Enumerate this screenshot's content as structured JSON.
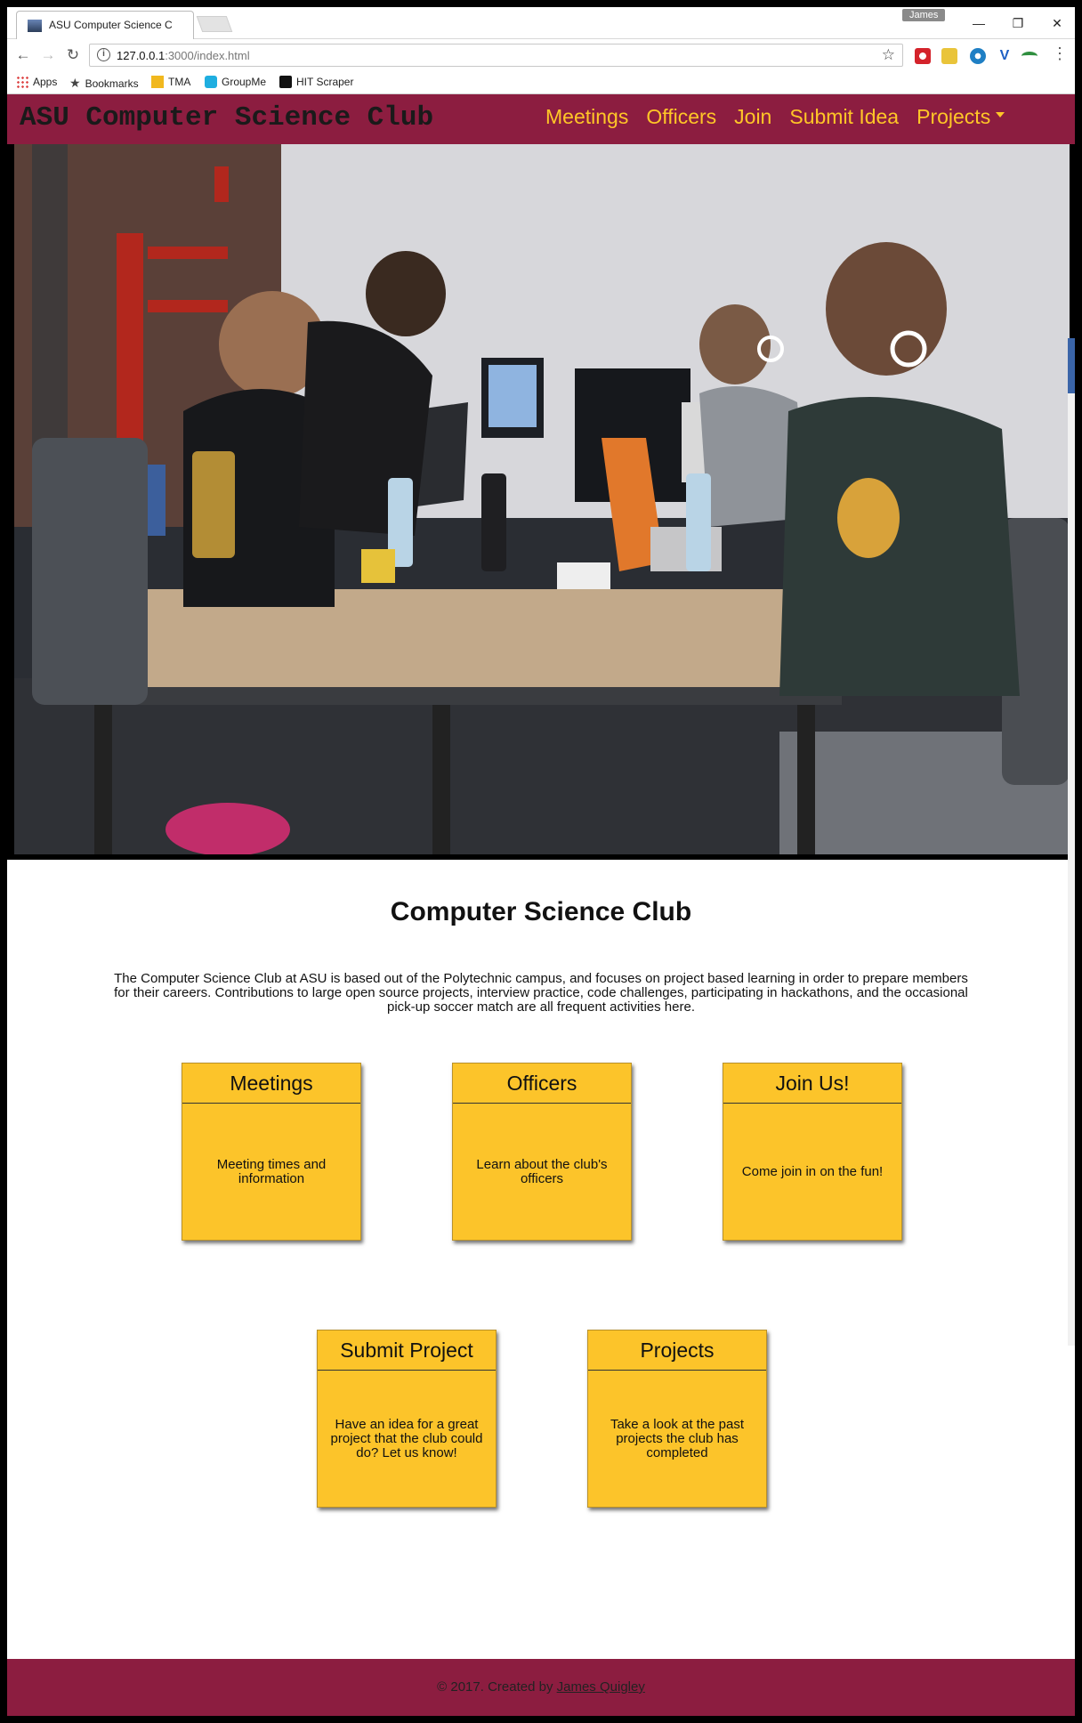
{
  "browser": {
    "tab_title": "ASU Computer Science C",
    "profile": "James",
    "url_host": "127.0.0.1",
    "url_path": ":3000/index.html",
    "bookmarks": [
      "Apps",
      "Bookmarks",
      "TMA",
      "GroupMe",
      "HIT Scraper"
    ]
  },
  "nav": {
    "brand": "ASU Computer Science Club",
    "links": [
      "Meetings",
      "Officers",
      "Join",
      "Submit Idea",
      "Projects"
    ]
  },
  "main": {
    "title": "Computer Science Club",
    "intro": "The Computer Science Club at ASU is based out of the Polytechnic campus, and focuses on project based learning in order to prepare members for their careers. Contributions to large open source projects, interview practice, code challenges, participating in hackathons, and the occasional pick-up soccer match are all frequent activities here.",
    "cards": [
      {
        "title": "Meetings",
        "text": "Meeting times and information"
      },
      {
        "title": "Officers",
        "text": "Learn about the club's officers"
      },
      {
        "title": "Join Us!",
        "text": "Come join in on the fun!"
      },
      {
        "title": "Submit Project",
        "text": "Have an idea for a great project that the club could do? Let us know!"
      },
      {
        "title": "Projects",
        "text": "Take a look at the past projects the club has completed"
      }
    ]
  },
  "footer": {
    "text": "© 2017. Created by ",
    "author": "James Quigley"
  },
  "colors": {
    "maroon": "#8c1d40",
    "gold": "#ffc627",
    "card": "#fcc42a"
  }
}
